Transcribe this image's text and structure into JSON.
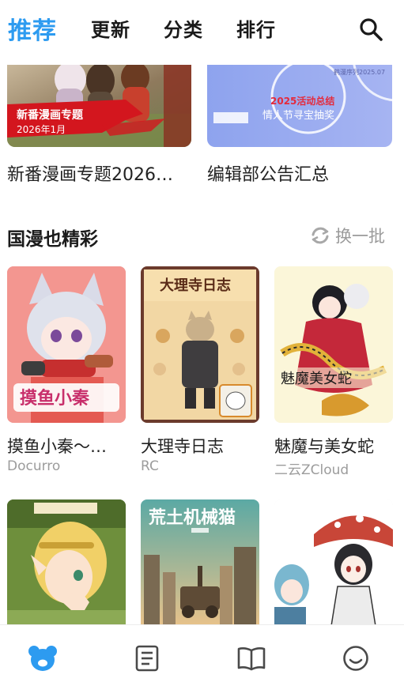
{
  "tabs": [
    {
      "label": "推荐",
      "active": true
    },
    {
      "label": "更新",
      "active": false
    },
    {
      "label": "分类",
      "active": false
    },
    {
      "label": "排行",
      "active": false
    }
  ],
  "banners": [
    {
      "title": "新番漫画专题2026…",
      "overlay_line1": "新番漫画专题",
      "overlay_line2": "2026年1月"
    },
    {
      "title": "编辑部公告汇总",
      "overlay_line1": "2025活动总结",
      "overlay_line2": "情人节寻宝抽奖",
      "small_text": "鹤漫序列2025.07"
    }
  ],
  "section": {
    "title": "国漫也精彩",
    "refresh_label": "换一批"
  },
  "comics": [
    {
      "title": "摸鱼小秦～…",
      "author": "Docurro",
      "cover_text": "摸鱼小秦"
    },
    {
      "title": "大理寺日志",
      "author": "RC",
      "cover_text": "大理寺日志"
    },
    {
      "title": "魅魔与美女蛇",
      "author": "二云ZCloud",
      "cover_text": "魅魔美女蛇"
    },
    {
      "title": "",
      "author": "",
      "cover_text": ""
    },
    {
      "title": "",
      "author": "",
      "cover_text": "荒土机械猫"
    },
    {
      "title": "",
      "author": "",
      "cover_text": ""
    }
  ],
  "bottom_nav": [
    {
      "icon": "bear-icon",
      "active": true,
      "color": "#2d9bf0"
    },
    {
      "icon": "document-list-icon",
      "active": false
    },
    {
      "icon": "open-book-icon",
      "active": false
    },
    {
      "icon": "smiley-icon",
      "active": false
    }
  ],
  "colors": {
    "accent": "#2d9bf0",
    "text": "#222222",
    "muted": "#9c9c9c"
  }
}
